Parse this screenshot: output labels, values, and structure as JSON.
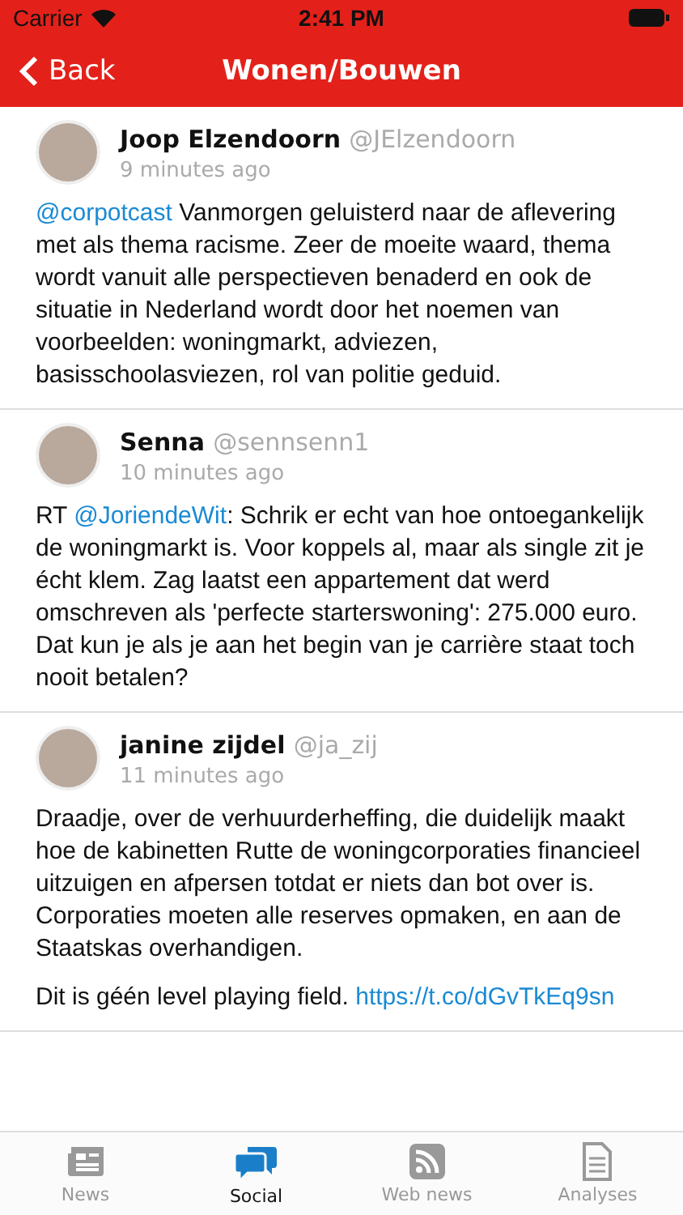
{
  "status_bar": {
    "carrier": "Carrier",
    "time": "2:41 PM"
  },
  "nav": {
    "back": "Back",
    "title": "Wonen/Bouwen"
  },
  "tweets": [
    {
      "name": "Joop Elzendoorn",
      "handle": "@JElzendoorn",
      "time": "9 minutes ago",
      "paragraphs": [
        [
          {
            "kind": "mention",
            "text": "@corpotcast"
          },
          {
            "kind": "text",
            "text": " Vanmorgen geluisterd naar de aflevering met als thema racisme.  Zeer de moeite waard, thema wordt vanuit alle perspectieven benaderd en ook de situatie in Nederland wordt door het noemen van voorbeelden: woningmarkt, adviezen, basisschoolasviezen, rol van politie geduid."
          }
        ]
      ]
    },
    {
      "name": "Senna",
      "handle": "@sennsenn1",
      "time": "10 minutes ago",
      "paragraphs": [
        [
          {
            "kind": "text",
            "text": "RT "
          },
          {
            "kind": "mention",
            "text": "@JoriendeWit"
          },
          {
            "kind": "text",
            "text": ": Schrik er echt van hoe ontoegankelijk de woningmarkt is. Voor koppels al, maar als single zit je écht klem. Zag laatst een appartement dat werd omschreven als 'perfecte starterswoning': 275.000 euro. Dat kun je als je aan het begin van je carrière staat toch nooit betalen?"
          }
        ]
      ]
    },
    {
      "name": "janine zijdel",
      "handle": "@ja_zij",
      "time": "11 minutes ago",
      "paragraphs": [
        [
          {
            "kind": "text",
            "text": "Draadje, over de verhuurderheffing, die duidelijk maakt hoe de kabinetten Rutte de woningcorporaties financieel uitzuigen en afpersen totdat er niets dan bot over is. Corporaties moeten alle reserves opmaken, en aan de Staatskas overhandigen."
          }
        ],
        [
          {
            "kind": "text",
            "text": "Dit is géén level playing field. "
          },
          {
            "kind": "link",
            "text": "https://t.co/dGvTkEq9sn"
          }
        ]
      ]
    }
  ],
  "tabs": [
    {
      "label": "News",
      "kind": "news",
      "selected": false
    },
    {
      "label": "Social",
      "kind": "social",
      "selected": true
    },
    {
      "label": "Web news",
      "kind": "rss",
      "selected": false
    },
    {
      "label": "Analyses",
      "kind": "document",
      "selected": false
    }
  ]
}
